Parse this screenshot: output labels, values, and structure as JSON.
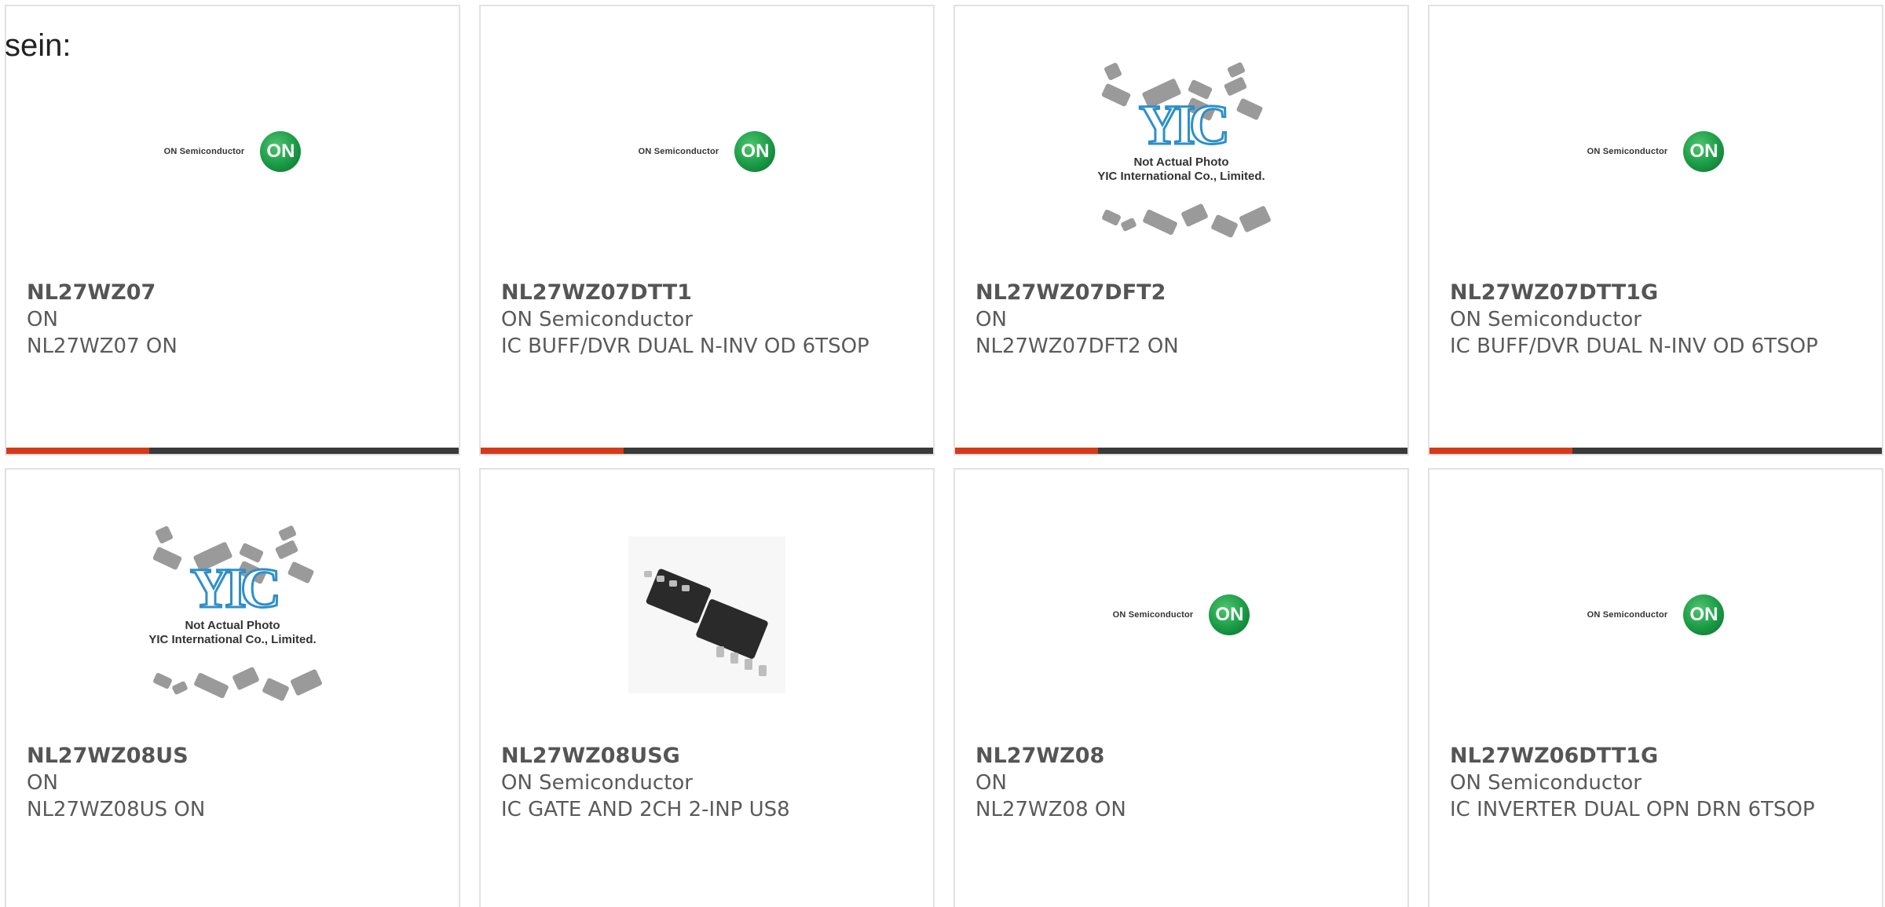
{
  "intro_text": "sein:",
  "colors": {
    "accent": "#d63a1a",
    "bar": "#3a3a3a",
    "border": "#e2e2e2",
    "logo_green": "#1a9a45"
  },
  "placeholder_caption_1": "Not Actual Photo",
  "placeholder_caption_2": "YIC International Co., Limited.",
  "on_logo_text": "ON Semiconductor",
  "on_logo_badge": "ON",
  "products": [
    {
      "part": "NL27WZ07",
      "maker": "ON",
      "desc": "NL27WZ07 ON",
      "image": "on-logo"
    },
    {
      "part": "NL27WZ07DTT1",
      "maker": "ON Semiconductor",
      "desc": "IC BUFF/DVR DUAL N-INV OD 6TSOP",
      "image": "on-logo"
    },
    {
      "part": "NL27WZ07DFT2",
      "maker": "ON",
      "desc": "NL27WZ07DFT2 ON",
      "image": "yic-placeholder"
    },
    {
      "part": "NL27WZ07DTT1G",
      "maker": "ON Semiconductor",
      "desc": "IC BUFF/DVR DUAL N-INV OD 6TSOP",
      "image": "on-logo"
    },
    {
      "part": "NL27WZ08US",
      "maker": "ON",
      "desc": "NL27WZ08US ON",
      "image": "yic-placeholder"
    },
    {
      "part": "NL27WZ08USG",
      "maker": "ON Semiconductor",
      "desc": "IC GATE AND 2CH 2-INP US8",
      "image": "ic-photo"
    },
    {
      "part": "NL27WZ08",
      "maker": "ON",
      "desc": "NL27WZ08 ON",
      "image": "on-logo"
    },
    {
      "part": "NL27WZ06DTT1G",
      "maker": "ON Semiconductor",
      "desc": "IC INVERTER DUAL OPN DRN 6TSOP",
      "image": "on-logo"
    }
  ]
}
